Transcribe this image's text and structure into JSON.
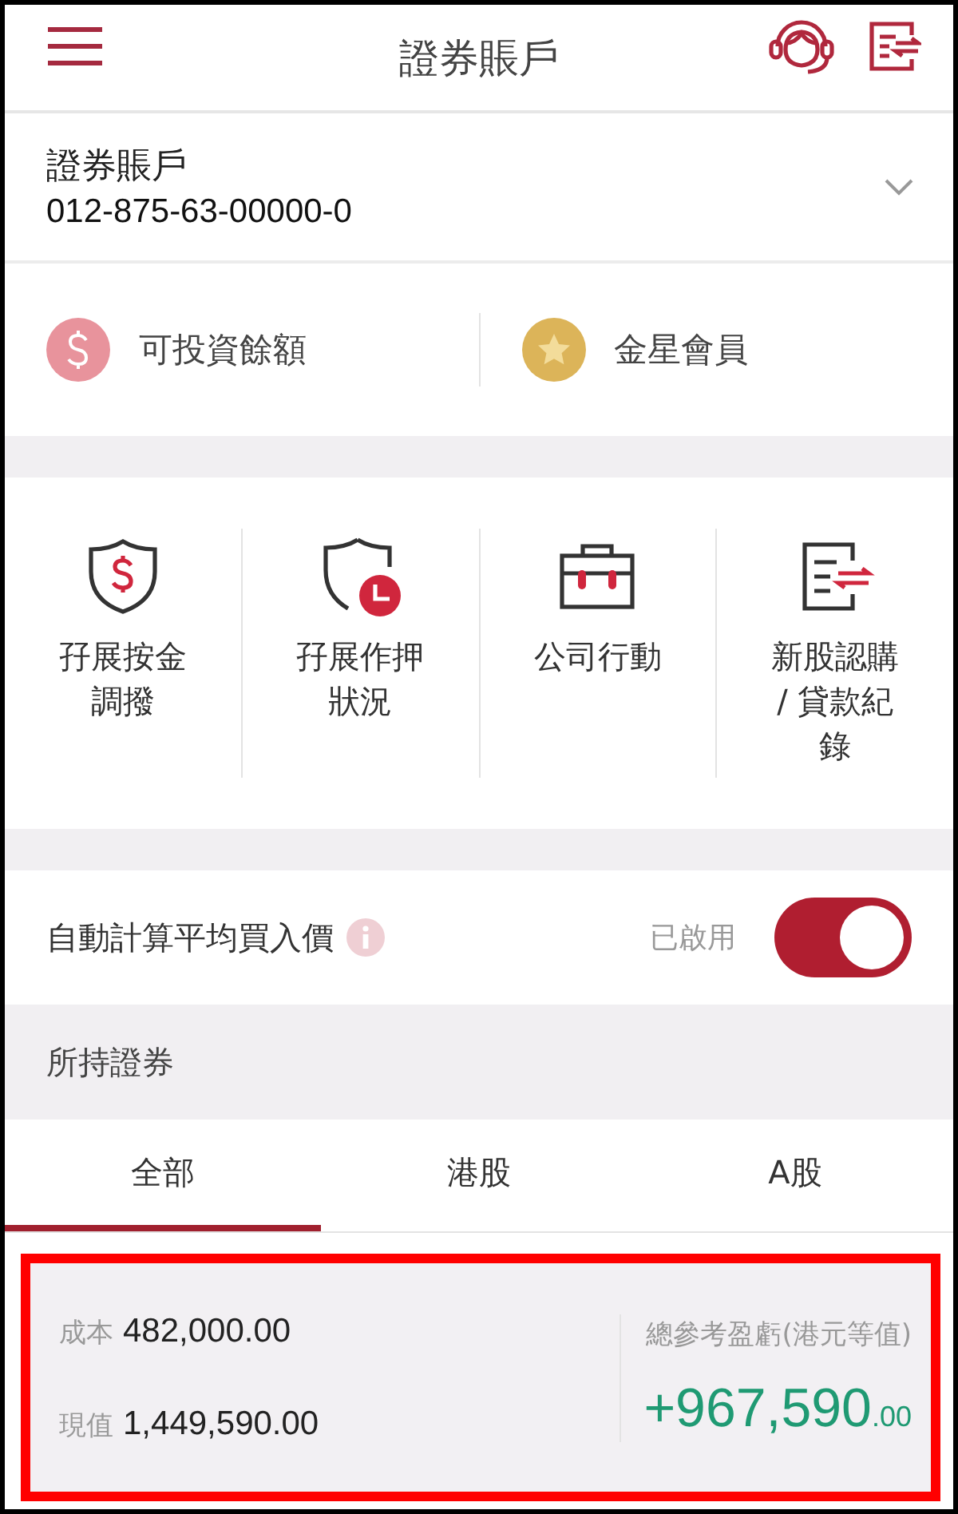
{
  "header": {
    "title": "證券賬戶"
  },
  "account": {
    "label": "證券賬戶",
    "number": "012-875-63-00000-0"
  },
  "quick_links": [
    {
      "label": "可投資餘額"
    },
    {
      "label": "金星會員"
    }
  ],
  "services": [
    {
      "label": "孖展按金調撥"
    },
    {
      "label": "孖展作押狀況"
    },
    {
      "label": "公司行動"
    },
    {
      "label": "新股認購 / 貸款紀錄"
    }
  ],
  "auto_average": {
    "label": "自動計算平均買入價",
    "status": "已啟用",
    "on": true
  },
  "holdings": {
    "title": "所持證券",
    "tabs": [
      {
        "label": "全部",
        "selected": true
      },
      {
        "label": "港股",
        "selected": false
      },
      {
        "label": "A股",
        "selected": false
      }
    ],
    "summary": {
      "cost_label": "成本",
      "cost": "482,000.00",
      "value_label": "現值",
      "value": "1,449,590.00",
      "pl_label": "總參考盈虧(港元等值)",
      "pl": "+967,590",
      "pl_decimals": ".00"
    }
  }
}
